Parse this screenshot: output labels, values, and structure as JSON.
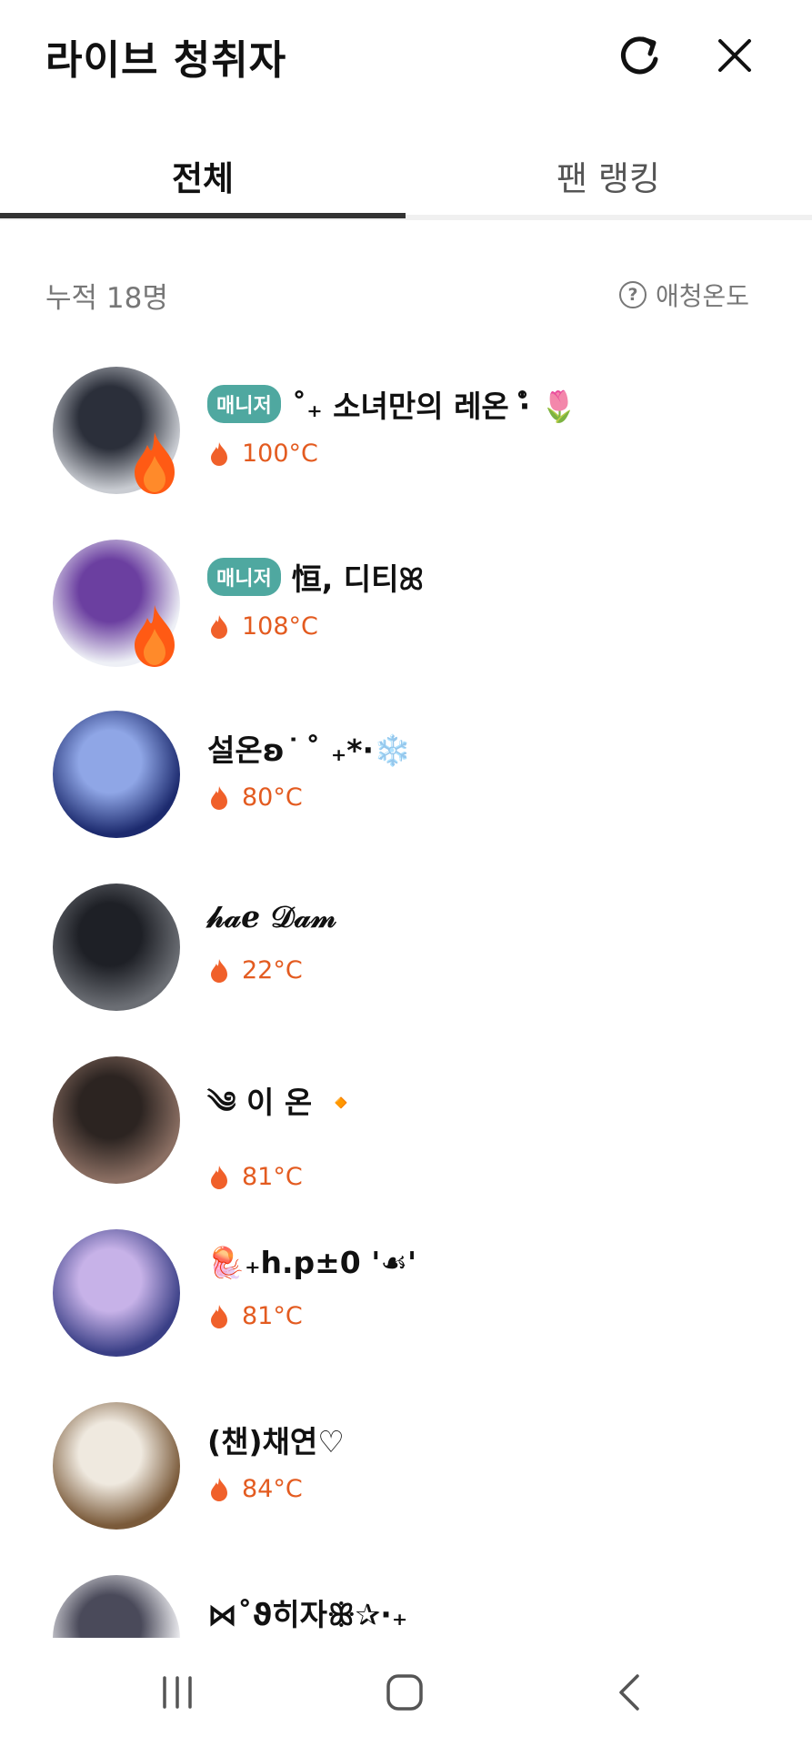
{
  "header": {
    "title": "라이브 청취자",
    "refresh_icon": "refresh-icon",
    "close_icon": "close-icon"
  },
  "tabs": [
    {
      "label": "전체",
      "selected": true
    },
    {
      "label": "팬 랭킹",
      "selected": false
    }
  ],
  "summary": {
    "count_label": "누적 18명",
    "affinity_label": "애청온도"
  },
  "colors": {
    "accent_orange": "#e35b20",
    "manager_badge": "#4fa8a0",
    "tab_indicator": "#333333"
  },
  "listeners": [
    {
      "badge": "매니저",
      "name": "˚₊ 소녀만의 레온 ‧̍̊ 🌷",
      "temp": "100°C",
      "fire": true,
      "avatar_colors": [
        "#c9ccd2",
        "#2b2f3a"
      ]
    },
    {
      "badge": "매니저",
      "name": "恒, 디티ꕤ",
      "temp": "108°C",
      "fire": true,
      "avatar_colors": [
        "#eef0f6",
        "#6b3fa0"
      ]
    },
    {
      "badge": "",
      "name": "설온ʚ ͘ ˚ ₊*·❄️",
      "temp": "80°C",
      "fire": false,
      "avatar_colors": [
        "#1c2a6e",
        "#8fa6e6"
      ]
    },
    {
      "badge": "",
      "name": "𝒽𝒶ℯ 𝒟𝒶𝓂",
      "temp": "22°C",
      "fire": false,
      "avatar_colors": [
        "#6b6e74",
        "#1e2026"
      ]
    },
    {
      "badge": "",
      "name": "༄ 이 온 🔸",
      "temp": "81°C",
      "fire": false,
      "avatar_colors": [
        "#8a6e62",
        "#2c2421"
      ]
    },
    {
      "badge": "",
      "name": "🪼₊h.p±0 '☙'",
      "temp": "81°C",
      "fire": false,
      "avatar_colors": [
        "#3a3f86",
        "#c7b2e8"
      ]
    },
    {
      "badge": "",
      "name": "(챈)채연♡",
      "temp": "84°C",
      "fire": false,
      "avatar_colors": [
        "#7a5a3a",
        "#efe9df"
      ]
    },
    {
      "badge": "",
      "name": "⋈˚ϑ히자ꕥ✰·₊",
      "temp": "",
      "fire": false,
      "avatar_colors": [
        "#f3f3f6",
        "#4a4a5a"
      ]
    }
  ],
  "navbar": {
    "recent_icon": "recent-apps-icon",
    "home_icon": "home-icon",
    "back_icon": "back-icon"
  }
}
